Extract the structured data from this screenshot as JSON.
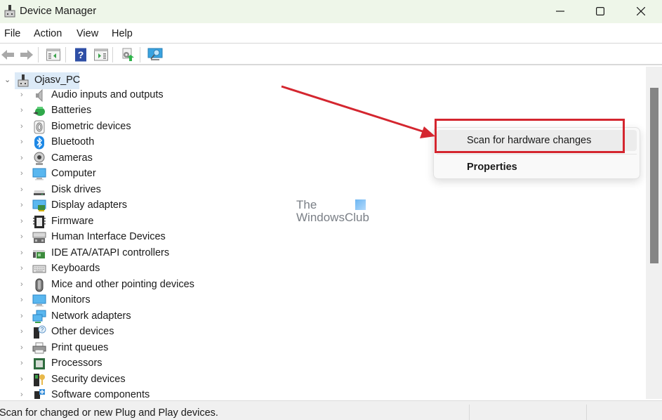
{
  "window": {
    "title": "Device Manager",
    "app_icon": "device-manager-icon",
    "controls": [
      "minimize",
      "maximize",
      "close"
    ]
  },
  "menubar": {
    "items": [
      {
        "label": "File"
      },
      {
        "label": "Action"
      },
      {
        "label": "View"
      },
      {
        "label": "Help"
      }
    ]
  },
  "toolbar": {
    "buttons": [
      {
        "icon": "back-arrow-icon",
        "enabled": false
      },
      {
        "icon": "forward-arrow-icon",
        "enabled": false
      },
      {
        "icon": "show-hide-console-tree-icon"
      },
      {
        "icon": "help-icon"
      },
      {
        "icon": "show-hide-action-pane-icon"
      },
      {
        "icon": "update-driver-icon"
      },
      {
        "icon": "scan-hardware-monitor-icon"
      }
    ]
  },
  "tree": {
    "root": {
      "label": "Ojasv_PC",
      "expanded": true,
      "selected": true,
      "icon": "computer-tower-icon"
    },
    "categories": [
      {
        "label": "Audio inputs and outputs",
        "icon": "speaker-icon"
      },
      {
        "label": "Batteries",
        "icon": "battery-icon"
      },
      {
        "label": "Biometric devices",
        "icon": "fingerprint-icon"
      },
      {
        "label": "Bluetooth",
        "icon": "bluetooth-icon"
      },
      {
        "label": "Cameras",
        "icon": "webcam-icon"
      },
      {
        "label": "Computer",
        "icon": "monitor-icon"
      },
      {
        "label": "Disk drives",
        "icon": "disk-drive-icon"
      },
      {
        "label": "Display adapters",
        "icon": "display-adapter-icon"
      },
      {
        "label": "Firmware",
        "icon": "firmware-chip-icon"
      },
      {
        "label": "Human Interface Devices",
        "icon": "hid-icon"
      },
      {
        "label": "IDE ATA/ATAPI controllers",
        "icon": "ide-controller-icon"
      },
      {
        "label": "Keyboards",
        "icon": "keyboard-icon"
      },
      {
        "label": "Mice and other pointing devices",
        "icon": "mouse-icon"
      },
      {
        "label": "Monitors",
        "icon": "monitor-icon"
      },
      {
        "label": "Network adapters",
        "icon": "network-adapter-icon"
      },
      {
        "label": "Other devices",
        "icon": "unknown-device-icon"
      },
      {
        "label": "Print queues",
        "icon": "printer-icon"
      },
      {
        "label": "Processors",
        "icon": "processor-icon"
      },
      {
        "label": "Security devices",
        "icon": "security-key-icon"
      },
      {
        "label": "Software components",
        "icon": "software-component-icon"
      }
    ]
  },
  "context_menu": {
    "items": [
      {
        "label": "Scan for hardware changes",
        "highlighted": true
      },
      {
        "label": "Properties",
        "bold": true
      }
    ]
  },
  "annotation": {
    "color": "#d4262f",
    "type": "arrow-and-box"
  },
  "watermark": {
    "line1": "The",
    "line2": "WindowsClub"
  },
  "statusbar": {
    "text": "Scan for changed or new Plug and Play devices."
  },
  "colors": {
    "titlebar_bg": "#eef6e9",
    "selection_bg": "#dceaf7",
    "annotation_red": "#d4262f",
    "scroll_thumb": "#858585"
  }
}
